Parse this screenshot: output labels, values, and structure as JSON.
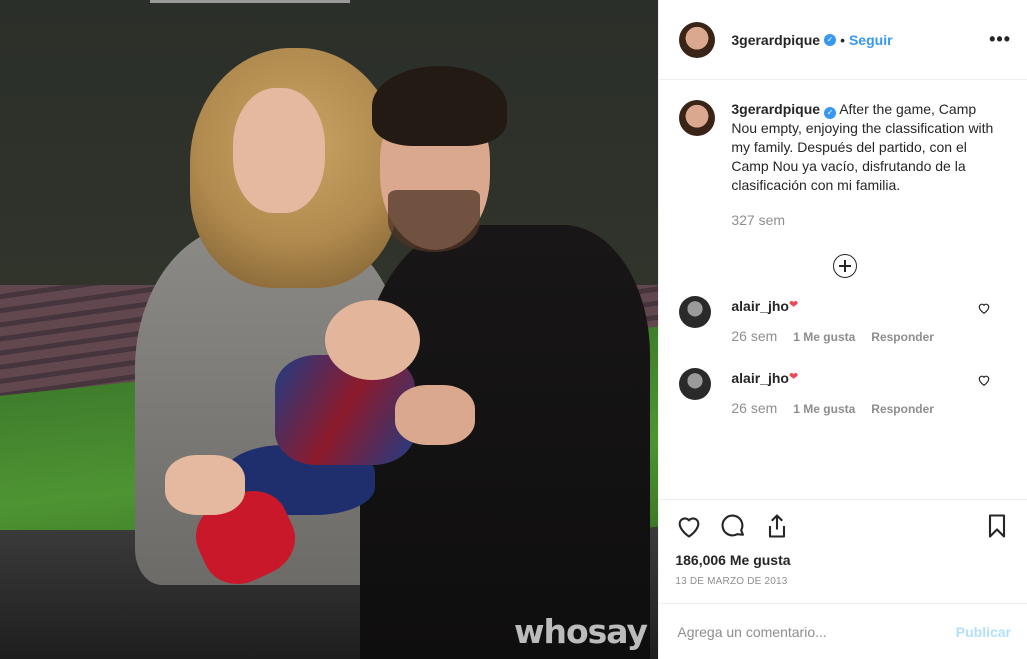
{
  "header": {
    "username": "3gerardpique",
    "separator": "•",
    "follow_label": "Seguir",
    "more_label": "•••"
  },
  "caption": {
    "username": "3gerardpique",
    "text": "After the game, Camp Nou empty, enjoying the classification with my family. Después del partido, con el Camp Nou ya vacío, disfrutando de la clasificación con mi familia.",
    "time": "327 sem"
  },
  "comments": [
    {
      "username": "alair_jho",
      "emoji": "❤",
      "time": "26 sem",
      "likes": "1 Me gusta",
      "reply": "Responder"
    },
    {
      "username": "alair_jho",
      "emoji": "❤",
      "time": "26 sem",
      "likes": "1 Me gusta",
      "reply": "Responder"
    }
  ],
  "icons": [
    "heart-icon",
    "comment-icon",
    "share-icon",
    "bookmark-icon",
    "load-more-icon",
    "verified-icon"
  ],
  "likes_count": "186,006 Me gusta",
  "date": "13 DE MARZO DE 2013",
  "add_comment": {
    "placeholder": "Agrega un comentario...",
    "publish_label": "Publicar"
  },
  "photo": {
    "watermark": "whosay"
  },
  "colors": {
    "link": "#3897f0",
    "publish_disabled": "#b2dffc",
    "muted": "#8e8e8e"
  }
}
